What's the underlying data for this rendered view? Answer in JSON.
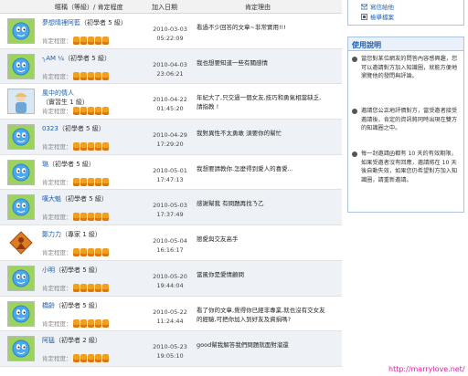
{
  "table": {
    "headers": {
      "user": "暱稱（等級）/ 肯定程度",
      "date": "加入日期",
      "reason": "肯定理由"
    },
    "rating_label": "肯定程度：",
    "rows": [
      {
        "name": "夢想晴裡阿藍",
        "level": "（初學者 5 級）",
        "date": "2010-03-03",
        "time": "05:22:09",
        "reason": "看過不少回答的文章~非常實用!!!",
        "stars": 5,
        "avatar": "green"
      },
      {
        "name": "╮AM ¼",
        "level": "（初學者 5 級）",
        "date": "2010-04-03",
        "time": "23:06:21",
        "reason": "我也想要知道一些有關感情",
        "stars": 5,
        "avatar": "green"
      },
      {
        "name": "風中的情人",
        "level": "（實習生 1 級）",
        "date": "2010-04-22",
        "time": "01:45:20",
        "reason": "年紀大了,只交過一個女友,技巧和勇氣相當缺乏,\n請指教 !",
        "stars": 5,
        "avatar": "photo"
      },
      {
        "name": "0323",
        "level": "（初學者 5 級）",
        "date": "2010-04-29",
        "time": "17:29:20",
        "reason": "我對異性不太勇敢 須要你的幫忙",
        "stars": 5,
        "avatar": "green"
      },
      {
        "name": "璐",
        "level": "（初學者 5 級）",
        "date": "2010-05-01",
        "time": "17:47:13",
        "reason": "我想要請教你.怎麼得到愛人的喜愛...",
        "stars": 5,
        "avatar": "green"
      },
      {
        "name": "嘆大魁",
        "level": "（初學者 5 級）",
        "date": "2010-05-03",
        "time": "17:37:49",
        "reason": "感謝幫我 有問題再找ㄋ乙",
        "stars": 5,
        "avatar": "green"
      },
      {
        "name": "鄭力力",
        "level": "（專家 1 級）",
        "date": "2010-05-04",
        "time": "16:16:17",
        "reason": "戀愛與交友高手",
        "stars": 5,
        "avatar": "rank"
      },
      {
        "name": "小明",
        "level": "（初學者 5 級）",
        "date": "2010-05-20",
        "time": "19:44:04",
        "reason": "當風你是愛情顧問",
        "stars": 5,
        "avatar": "green"
      },
      {
        "name": "橋齡",
        "level": "（初學者 5 級）",
        "date": "2010-05-22",
        "time": "11:24:44",
        "reason": "看了你的文章,覺得你已經非專業,就也沒有交女友\n的經驗,可把你加入到好友及資捐嗎?",
        "stars": 5,
        "avatar": "green"
      },
      {
        "name": "阿猛",
        "level": "（初學者 2 級）",
        "date": "2010-05-23",
        "time": "19:05:10",
        "reason": "good幫我解答我們問題就面對溜還",
        "stars": 5,
        "avatar": "green"
      }
    ]
  },
  "sidebar": {
    "links": [
      {
        "label": "寫信給他",
        "icon": "mail-icon"
      },
      {
        "label": "檢舉檔案",
        "icon": "report-icon"
      }
    ],
    "help": {
      "title": "使用說明",
      "items": [
        "當您對某位網友的問答內容感興趣，您可以邀請對方加入知識圈，就能方便地瀏覽他的發問與評論。",
        "邀請您公正地評價對方，當受邀者接受邀請後，肯定的資訊將同時出現在雙方的知識圈之中。",
        "每一封邀請函都有 10 天的有效期限，如果受邀者沒有回應，邀請將在 10 天後自動失效，如果您仍希望對方加入知識圈，請重新邀請。"
      ]
    }
  },
  "watermark": "http://marrylove.net/",
  "colors": {
    "accent": "#1f5fb0",
    "star_on": "#f0a020",
    "star_off": "#cfcfcf",
    "watermark": "#e020a0"
  }
}
